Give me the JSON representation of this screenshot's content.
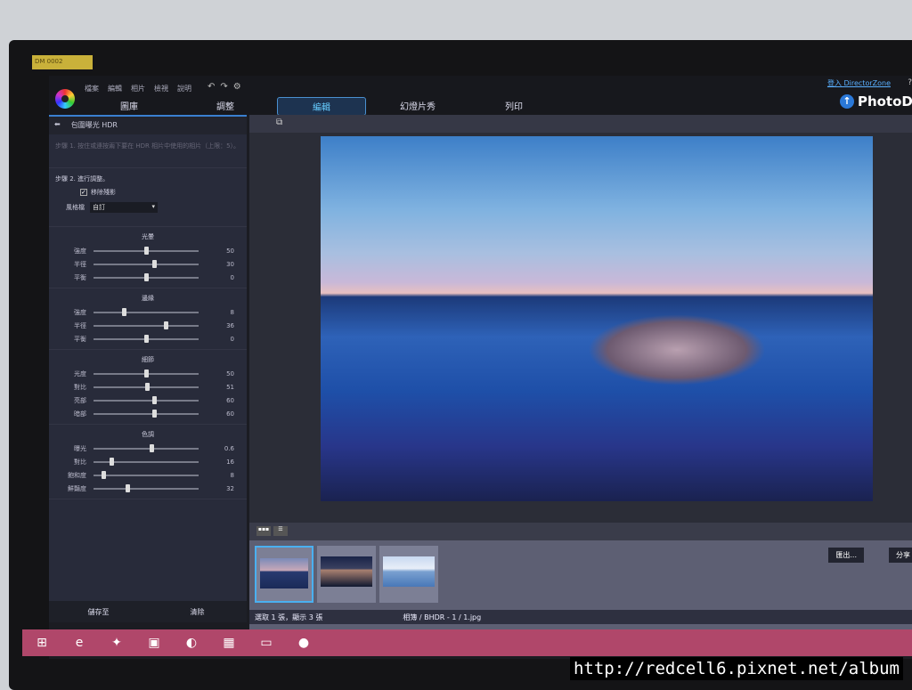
{
  "label_tape": "DM 0002",
  "menu": [
    "檔案",
    "編輯",
    "相片",
    "檢視",
    "說明"
  ],
  "tabs": [
    {
      "label": "圖庫"
    },
    {
      "label": "調整"
    },
    {
      "label": "編輯",
      "active": true
    },
    {
      "label": "幻燈片秀"
    },
    {
      "label": "列印"
    }
  ],
  "header": {
    "login": "登入 DirectorZone",
    "help": "?",
    "brand": "PhotoDi"
  },
  "panel": {
    "title": "包圍曝光 HDR",
    "step1": "步驟 1. 按住或連按兩下要在 HDR 相片中使用的相片（上限：5）。",
    "step2": "步驟 2. 進行調整。",
    "remove_ghost": "移除殘影",
    "remove_ghost_checked": true,
    "preset_label": "風格檔",
    "preset_value": "自訂",
    "sections": [
      {
        "title": "光暈",
        "sliders": [
          {
            "label": "強度",
            "value": "50",
            "pos": 0.5
          },
          {
            "label": "半徑",
            "value": "30",
            "pos": 0.58
          },
          {
            "label": "平衡",
            "value": "0",
            "pos": 0.5
          }
        ]
      },
      {
        "title": "邊緣",
        "sliders": [
          {
            "label": "強度",
            "value": "8",
            "pos": 0.28
          },
          {
            "label": "半徑",
            "value": "36",
            "pos": 0.7
          },
          {
            "label": "平衡",
            "value": "0",
            "pos": 0.5
          }
        ]
      },
      {
        "title": "細節",
        "sliders": [
          {
            "label": "光度",
            "value": "50",
            "pos": 0.5
          },
          {
            "label": "對比",
            "value": "51",
            "pos": 0.51
          },
          {
            "label": "亮部",
            "value": "60",
            "pos": 0.58
          },
          {
            "label": "暗部",
            "value": "60",
            "pos": 0.58
          }
        ]
      },
      {
        "title": "色調",
        "sliders": [
          {
            "label": "曝光",
            "value": "0.6",
            "pos": 0.56
          },
          {
            "label": "對比",
            "value": "16",
            "pos": 0.16
          },
          {
            "label": "飽和度",
            "value": "8",
            "pos": 0.08
          },
          {
            "label": "鮮豔度",
            "value": "32",
            "pos": 0.32
          }
        ]
      }
    ],
    "save": "儲存至",
    "clear": "清除"
  },
  "filmstrip": {
    "export": "匯出...",
    "share": "分享",
    "status": "選取 1 張，顯示 3 張",
    "path": "相簿 / BHDR - 1 / 1.jpg"
  },
  "watermark": "http://redcell6.pixnet.net/album"
}
